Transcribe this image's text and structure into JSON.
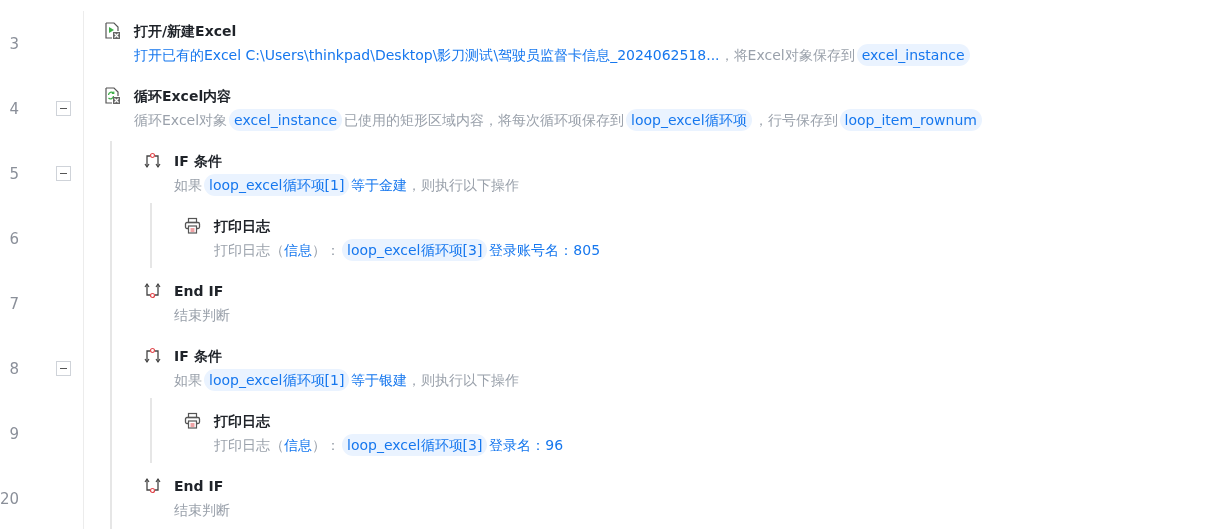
{
  "steps": [
    {
      "line": "3",
      "kind": "excel_open",
      "title": "打开/新建Excel",
      "description": [
        {
          "kind": "value",
          "text": "打开已有的Excel C:\\Users\\thinkpad\\Desktop\\影刀测试\\驾驶员监督卡信息_2024062518..."
        },
        {
          "kind": "text",
          "text": "，将Excel对象保存到"
        },
        {
          "kind": "var",
          "text": "excel_instance"
        }
      ]
    },
    {
      "line": "4",
      "kind": "excel_loop",
      "title": "循环Excel内容",
      "expanded": true,
      "description": [
        {
          "kind": "text",
          "text": "循环Excel对象"
        },
        {
          "kind": "var",
          "text": "excel_instance"
        },
        {
          "kind": "text",
          "text": "已使用的矩形区域内容，将每次循环项保存到"
        },
        {
          "kind": "var",
          "text": "loop_excel循环项"
        },
        {
          "kind": "text",
          "text": "，行号保存到"
        },
        {
          "kind": "var",
          "text": "loop_item_rownum"
        }
      ],
      "children": [
        {
          "line": "5",
          "kind": "if",
          "title": "IF 条件",
          "expanded": true,
          "description": [
            {
              "kind": "text",
              "text": "如果"
            },
            {
              "kind": "var",
              "text": "loop_excel循环项[1]"
            },
            {
              "kind": "value",
              "text": "等于金建"
            },
            {
              "kind": "text",
              "text": "，则执行以下操作"
            }
          ],
          "children": [
            {
              "line": "6",
              "kind": "print",
              "title": "打印日志",
              "description": [
                {
                  "kind": "text",
                  "text": "打印日志（"
                },
                {
                  "kind": "value",
                  "text": "信息"
                },
                {
                  "kind": "text",
                  "text": "）："
                },
                {
                  "kind": "var",
                  "text": "loop_excel循环项[3]"
                },
                {
                  "kind": "value",
                  "text": "登录账号名：805"
                }
              ]
            }
          ]
        },
        {
          "line": "7",
          "kind": "endif",
          "title": "End IF",
          "description": [
            {
              "kind": "text",
              "text": "结束判断"
            }
          ]
        },
        {
          "line": "8",
          "kind": "if",
          "title": "IF 条件",
          "expanded": true,
          "description": [
            {
              "kind": "text",
              "text": "如果"
            },
            {
              "kind": "var",
              "text": "loop_excel循环项[1]"
            },
            {
              "kind": "value",
              "text": "等于银建"
            },
            {
              "kind": "text",
              "text": "，则执行以下操作"
            }
          ],
          "children": [
            {
              "line": "9",
              "kind": "print",
              "title": "打印日志",
              "description": [
                {
                  "kind": "text",
                  "text": "打印日志（"
                },
                {
                  "kind": "value",
                  "text": "信息"
                },
                {
                  "kind": "text",
                  "text": "）："
                },
                {
                  "kind": "var",
                  "text": "loop_excel循环项[3]"
                },
                {
                  "kind": "value",
                  "text": "登录名：96"
                }
              ]
            }
          ]
        },
        {
          "line": "20",
          "kind": "endif",
          "title": "End IF",
          "description": [
            {
              "kind": "text",
              "text": "结束判断"
            }
          ]
        }
      ]
    }
  ]
}
